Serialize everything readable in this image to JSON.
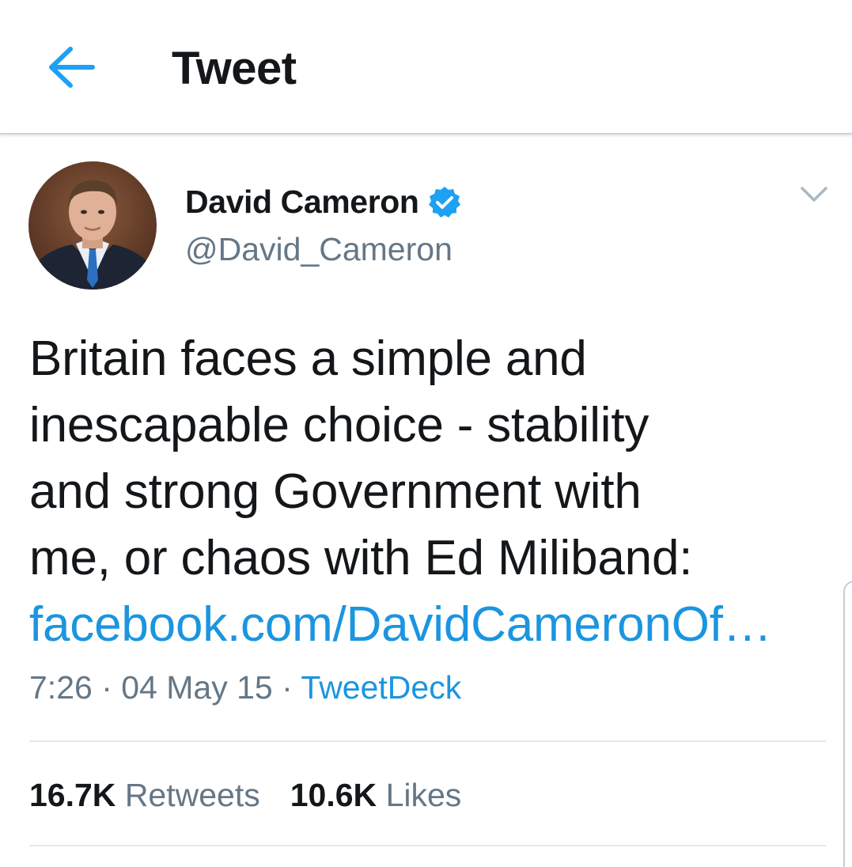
{
  "header": {
    "title": "Tweet",
    "back_icon": "arrow-left-icon",
    "accent_color": "#1da1f2"
  },
  "tweet": {
    "author": {
      "display_name": "David Cameron",
      "handle": "@David_Cameron",
      "verified": true,
      "verified_icon": "verified-badge-icon"
    },
    "caret_icon": "chevron-down-icon",
    "text_lines": [
      "Britain faces a simple and",
      "inescapable choice - stability",
      "and strong Government with",
      "me, or chaos with Ed Miliband:"
    ],
    "link_text": "facebook.com/DavidCameronOf…",
    "time": "7:26",
    "date": "04 May 15",
    "separator": " · ",
    "source": "TweetDeck",
    "stats": {
      "retweets_count": "16.7K",
      "retweets_label": "Retweets",
      "likes_count": "10.6K",
      "likes_label": "Likes"
    }
  },
  "colors": {
    "link": "#1b95e0",
    "secondary_text": "#657786",
    "primary_text": "#14171a",
    "verified": "#1da1f2"
  }
}
